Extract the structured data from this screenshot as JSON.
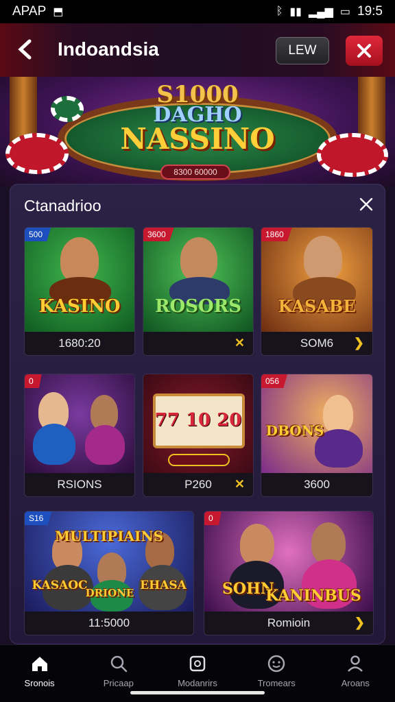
{
  "status_bar": {
    "app_label": "APAP",
    "time": "19:5",
    "icons": [
      "notification-icon",
      "bluetooth-icon",
      "vibrate-icon",
      "signal-icon",
      "battery-icon"
    ]
  },
  "header": {
    "title": "Indoandsia",
    "lew_label": "LEW",
    "close_label": "✕",
    "back_label": "‹"
  },
  "banner": {
    "line1": "S1000",
    "line2": "DAGHO",
    "line3": "NASSINO",
    "pill_text": "8300 60000"
  },
  "panel": {
    "title": "Ctanadrioo",
    "close_label": "✕"
  },
  "games": [
    {
      "badge": "500",
      "name": "KASINO",
      "foot": "1680:20",
      "foot_icon": "",
      "badge_color": "#1d4fbf"
    },
    {
      "badge": "3600",
      "name": "ROSORS",
      "foot": "",
      "foot_icon": "✕",
      "badge_color": "#c81830"
    },
    {
      "badge": "1860",
      "name": "KASABE",
      "foot": "SOM6",
      "foot_icon": "❯",
      "badge_color": "#c81830"
    },
    {
      "badge": "0",
      "name": "",
      "foot": "RSIONS",
      "foot_icon": "",
      "badge_color": "#c81830"
    },
    {
      "badge": "",
      "name": "77 10 20",
      "foot": "P260",
      "foot_icon": "✕",
      "badge_color": "#c81830"
    },
    {
      "badge": "056",
      "name": "DBONS",
      "foot": "3600",
      "foot_icon": "",
      "badge_color": "#c81830"
    },
    {
      "badge": "S16",
      "name": "MULTIPIAINS",
      "foot": "11:5000",
      "foot_icon": "",
      "badge_color": "#1d4fbf"
    },
    {
      "badge": "0",
      "name": "KANINBUS",
      "foot": "Romioin",
      "foot_icon": "❯",
      "badge_color": "#c81830"
    }
  ],
  "card_names_extra": {
    "card6_left": "KASAOC",
    "card6_center": "DRIONE",
    "card6_right": "EHASA",
    "card7_left": "SOHN"
  },
  "nav": [
    {
      "label": "Sronois",
      "icon": "home-icon",
      "active": true
    },
    {
      "label": "Pricaap",
      "icon": "search-icon",
      "active": false
    },
    {
      "label": "Modanrirs",
      "icon": "square-icon",
      "active": false
    },
    {
      "label": "Tromears",
      "icon": "face-icon",
      "active": false
    },
    {
      "label": "Aroans",
      "icon": "profile-icon",
      "active": false
    }
  ]
}
